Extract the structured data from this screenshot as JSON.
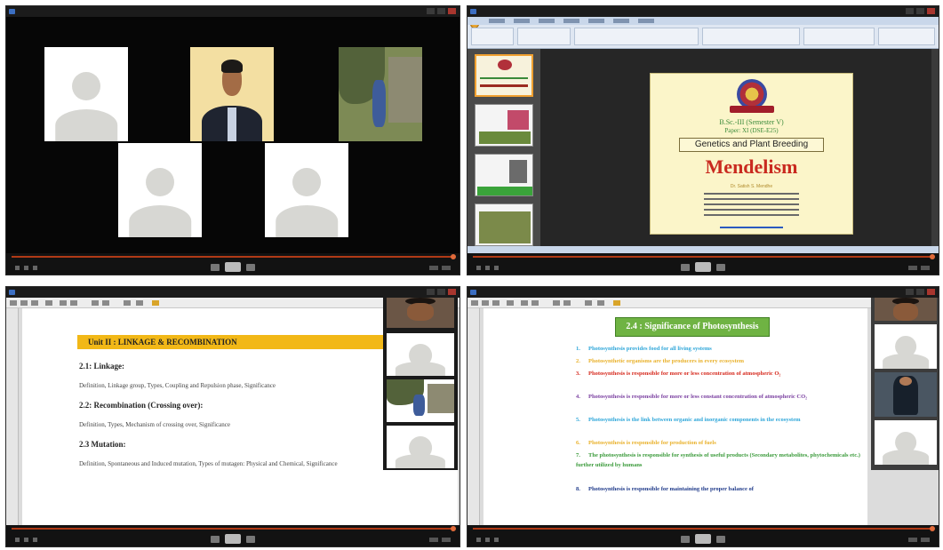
{
  "ppt_slide": {
    "line1": "B.Sc.-III (Semester V)",
    "line2": "Paper: XI (DSE-E25)",
    "course": "Genetics and Plant Breeding",
    "title": "Mendelism",
    "author": "Dr. Satish S. Mendhe"
  },
  "unit_doc": {
    "unit_heading": "Unit II : LINKAGE & RECOMBINATION",
    "sections": [
      {
        "heading": "2.1: Linkage:",
        "body": "Definition, Linkage group, Types, Coupling and Repulsion phase, Significance"
      },
      {
        "heading": "2.2: Recombination (Crossing over):",
        "body": "Definition, Types, Mechanism of crossing over, Significance"
      },
      {
        "heading": "2.3 Mutation:",
        "body": "Definition, Spontaneous and Induced mutation, Types of mutagen: Physical and Chemical, Significance"
      }
    ]
  },
  "photo_doc": {
    "title": "2.4 : Significance of Photosynthesis",
    "items": [
      {
        "num": "1.",
        "text": "Photosynthesis provides food for all living systems",
        "color": "#2ea6d9"
      },
      {
        "num": "2.",
        "text": "Photosynthetic organisms are the producers in every ecosystem",
        "color": "#e9b12b"
      },
      {
        "num": "3.",
        "text": "Photosynthesis is responsible for more or less concentration of atmospheric O₂",
        "color": "#d62a1e"
      },
      {
        "num": "4.",
        "text": "Photosynthesis is responsible for more or less constant concentration of atmospheric CO₂",
        "color": "#7a3fa0"
      },
      {
        "num": "5.",
        "text": "Photosynthesis is the link between organic and inorganic components in the ecosystem",
        "color": "#2ea6d9"
      },
      {
        "num": "6.",
        "text": "Photosynthesis is responsible for production of fuels",
        "color": "#e9b12b"
      },
      {
        "num": "7.",
        "text": "The photosynthesis is responsible for synthesis of useful products (Secondary metabolites, phytochemicals etc.) further utilized by humans",
        "color": "#3a9a3a"
      },
      {
        "num": "8.",
        "text": "Photosynthesis is responsible for maintaining the proper balance of",
        "color": "#1f3a8a"
      }
    ]
  }
}
